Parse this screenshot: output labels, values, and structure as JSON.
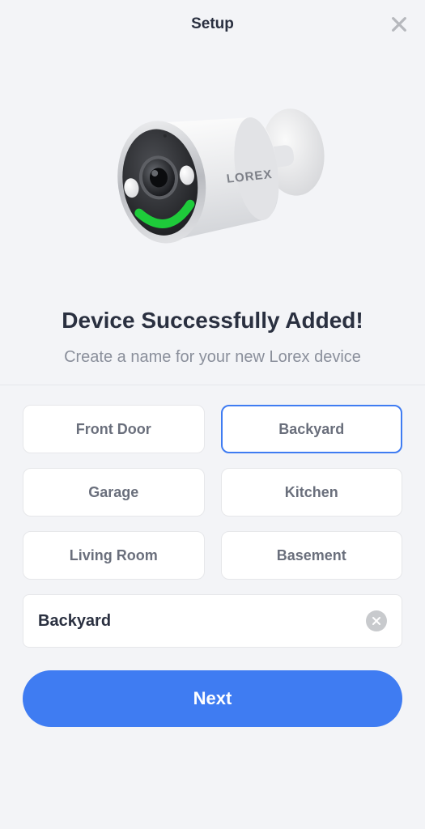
{
  "header": {
    "title": "Setup"
  },
  "product_brand": "LOREX",
  "messages": {
    "title": "Device Successfully Added!",
    "subtitle": "Create a name for your new Lorex device"
  },
  "name_suggestions": [
    "Front Door",
    "Backyard",
    "Garage",
    "Kitchen",
    "Living Room",
    "Basement"
  ],
  "selected_suggestion_index": 1,
  "name_field": {
    "value": "Backyard"
  },
  "buttons": {
    "next": "Next"
  }
}
